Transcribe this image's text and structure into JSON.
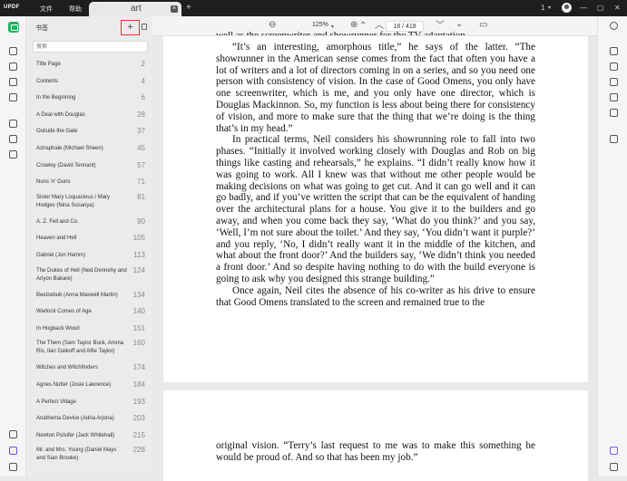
{
  "app": {
    "logo": "UPDF",
    "menu": [
      "文件",
      "帮助"
    ],
    "tab_hint": "::",
    "tab_title": "art",
    "tab_close": "×",
    "new_tab": "+",
    "version": "1",
    "version_caret": "▾"
  },
  "panel": {
    "title": "书签",
    "add_label": "+",
    "search_placeholder": "搜索",
    "bookmarks": [
      {
        "label": "Title Page",
        "page": "2",
        "rows": 1
      },
      {
        "label": "Contents",
        "page": "4",
        "rows": 1
      },
      {
        "label": "In the Beginning",
        "page": "6",
        "rows": 1
      },
      {
        "label": "A Deal with Douglas",
        "page": "28",
        "rows": 1
      },
      {
        "label": "Outside the Gate",
        "page": "37",
        "rows": 1
      },
      {
        "label": "Aziraphale (Michael Sheen)",
        "page": "45",
        "rows": 1
      },
      {
        "label": "Crowley (David Tennant)",
        "page": "57",
        "rows": 1
      },
      {
        "label": "Nuns ‘n’ Guns",
        "page": "71",
        "rows": 1
      },
      {
        "label": "Sister Mary Loquacious / Mary Hodges (Nina Sosanya)",
        "page": "81",
        "rows": 2
      },
      {
        "label": "A. Z. Fell and Co.",
        "page": "90",
        "rows": 1
      },
      {
        "label": "Heaven and Hell",
        "page": "105",
        "rows": 1
      },
      {
        "label": "Gabriel (Jon Hamm)",
        "page": "113",
        "rows": 1
      },
      {
        "label": "The Dukes of Hell (Ned Dennehy and Ariyon Bakare)",
        "page": "124",
        "rows": 2
      },
      {
        "label": "Beelzebub (Anna Maxwell Martin)",
        "page": "134",
        "rows": 1
      },
      {
        "label": "Warlock Comes of Age",
        "page": "140",
        "rows": 1
      },
      {
        "label": "In Hogback Wood",
        "page": "151",
        "rows": 1
      },
      {
        "label": "The Them (Sam Taylor Buck, Amma Ris, Ilan Galkoff and Alfie Taylor)",
        "page": "160",
        "rows": 2
      },
      {
        "label": "Witches and Witchfinders",
        "page": "174",
        "rows": 1
      },
      {
        "label": "Agnes Nutter (Josie Lawrence)",
        "page": "184",
        "rows": 1
      },
      {
        "label": "A Perfect Village",
        "page": "193",
        "rows": 1
      },
      {
        "label": "Anathema Device (Adria Arjona)",
        "page": "203",
        "rows": 1
      },
      {
        "label": "Newton Pulsifer (Jack Whitehall)",
        "page": "215",
        "rows": 1
      },
      {
        "label": "Mr. and Mrs. Young (Daniel Mays and Sian Brooke)",
        "page": "228",
        "rows": 2
      }
    ]
  },
  "toolbar": {
    "zoom_out": "⊖",
    "zoom": "125%",
    "zoom_caret": "▾",
    "zoom_in": "⊕",
    "first": "⌃",
    "prev": "︿",
    "page_indicator": "18 / 418",
    "next": "﹀",
    "last": "⌄",
    "comment": "▭"
  },
  "document": {
    "page1_paragraphs": [
      {
        "indent": true,
        "text": "“It’s an interesting, amorphous title,” he says of the latter. “The showrunner in the American sense comes from the fact that often you have a lot of writers and a lot of directors coming in on a series, and so you need one person with consistency of vision. In the case of Good Omens, you only have one screenwriter, which is me, and you only have one director, which is Douglas Mackinnon. So, my function is less about being there for consistency of vision, and more to make sure that the thing that we’re doing is the thing that’s in my head.”"
      },
      {
        "indent": true,
        "text": "In practical terms, Neil considers his showrunning role to fall into two phases. “Initially it involved working closely with Douglas and Rob on big things like casting and rehearsals,” he explains. “I didn’t really know how it was going to work. All I knew was that without me other people would be making decisions on what was going to get cut. And it can go well and it can go badly, and if you’ve written the script that can be the equivalent of handing over the architectural plans for a house. You give it to the builders and go away, and when you come back they say, ‘What do you think?’ and you say, ‘Well, I’m not sure about the toilet.’ And they say, ‘You didn’t want it purple?’ and you reply, ‘No, I didn’t really want it in the middle of the kitchen, and what about the front door?’ And the builders say, ‘We didn’t think you needed a front door.’ And so despite having nothing to do with the build everyone is going to ask why you designed this strange building.”"
      },
      {
        "indent": true,
        "text": "Once again, Neil cites the absence of his co-writer as his drive to ensure that Good Omens translated to the screen and remained true to the"
      }
    ],
    "page2_paragraphs": [
      {
        "indent": false,
        "text": "original vision. “Terry’s last request to me was to make this something he would be proud of. And so that has been my job.”"
      }
    ]
  }
}
